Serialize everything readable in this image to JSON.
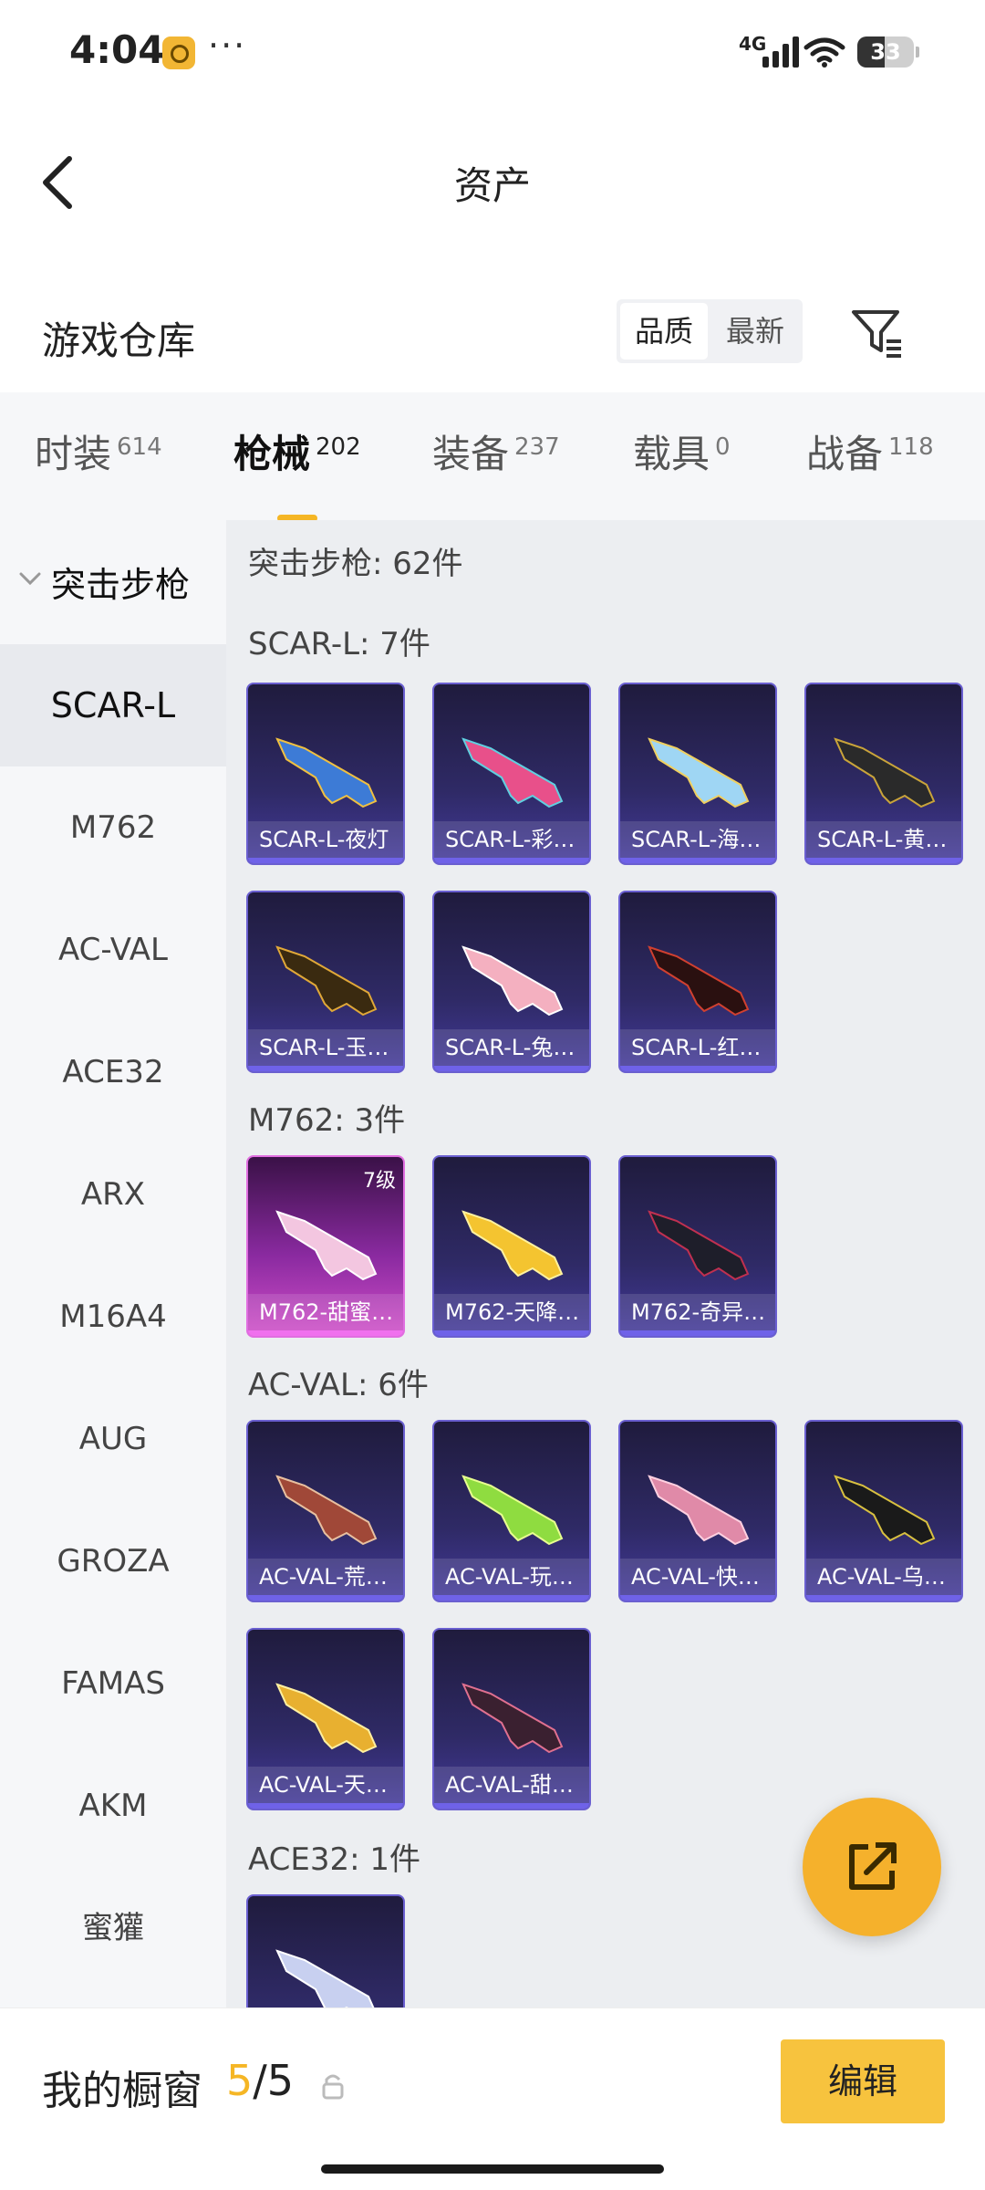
{
  "status_bar": {
    "time": "4:04",
    "dots": "···",
    "network": "4G",
    "battery": "33"
  },
  "header": {
    "title": "资产"
  },
  "section": {
    "title": "游戏仓库",
    "sort_options": [
      "品质",
      "最新"
    ]
  },
  "tabs": [
    {
      "name": "时装",
      "count": "614"
    },
    {
      "name": "枪械",
      "count": "202"
    },
    {
      "name": "装备",
      "count": "237"
    },
    {
      "name": "载具",
      "count": "0"
    },
    {
      "name": "战备",
      "count": "118"
    }
  ],
  "sidebar": {
    "group": "突击步枪",
    "items": [
      "SCAR-L",
      "M762",
      "AC-VAL",
      "ACE32",
      "ARX",
      "M16A4",
      "AUG",
      "GROZA",
      "FAMAS",
      "AKM",
      "蜜獾"
    ]
  },
  "content": {
    "summary": "突击步枪: 62件",
    "groups": [
      {
        "title": "SCAR-L: 7件",
        "items": [
          "SCAR-L-夜灯",
          "SCAR-L-彩…",
          "SCAR-L-海…",
          "SCAR-L-黄…",
          "SCAR-L-玉…",
          "SCAR-L-兔…",
          "SCAR-L-红…"
        ]
      },
      {
        "title": "M762: 3件",
        "items": [
          "M762-甜蜜…",
          "M762-天降…",
          "M762-奇异…"
        ],
        "level_badge": "7级"
      },
      {
        "title": "AC-VAL: 6件",
        "items": [
          "AC-VAL-荒…",
          "AC-VAL-玩…",
          "AC-VAL-快…",
          "AC-VAL-乌…",
          "AC-VAL-天…",
          "AC-VAL-甜…"
        ]
      },
      {
        "title": "ACE32: 1件",
        "items": [
          ""
        ]
      }
    ]
  },
  "bottom": {
    "label": "我的橱窗",
    "current": "5",
    "total": "/5",
    "edit": "编辑"
  },
  "colors": {
    "accent": "#f5b625",
    "card_blue": "#2f2a66",
    "card_pink": "#c040c0"
  }
}
